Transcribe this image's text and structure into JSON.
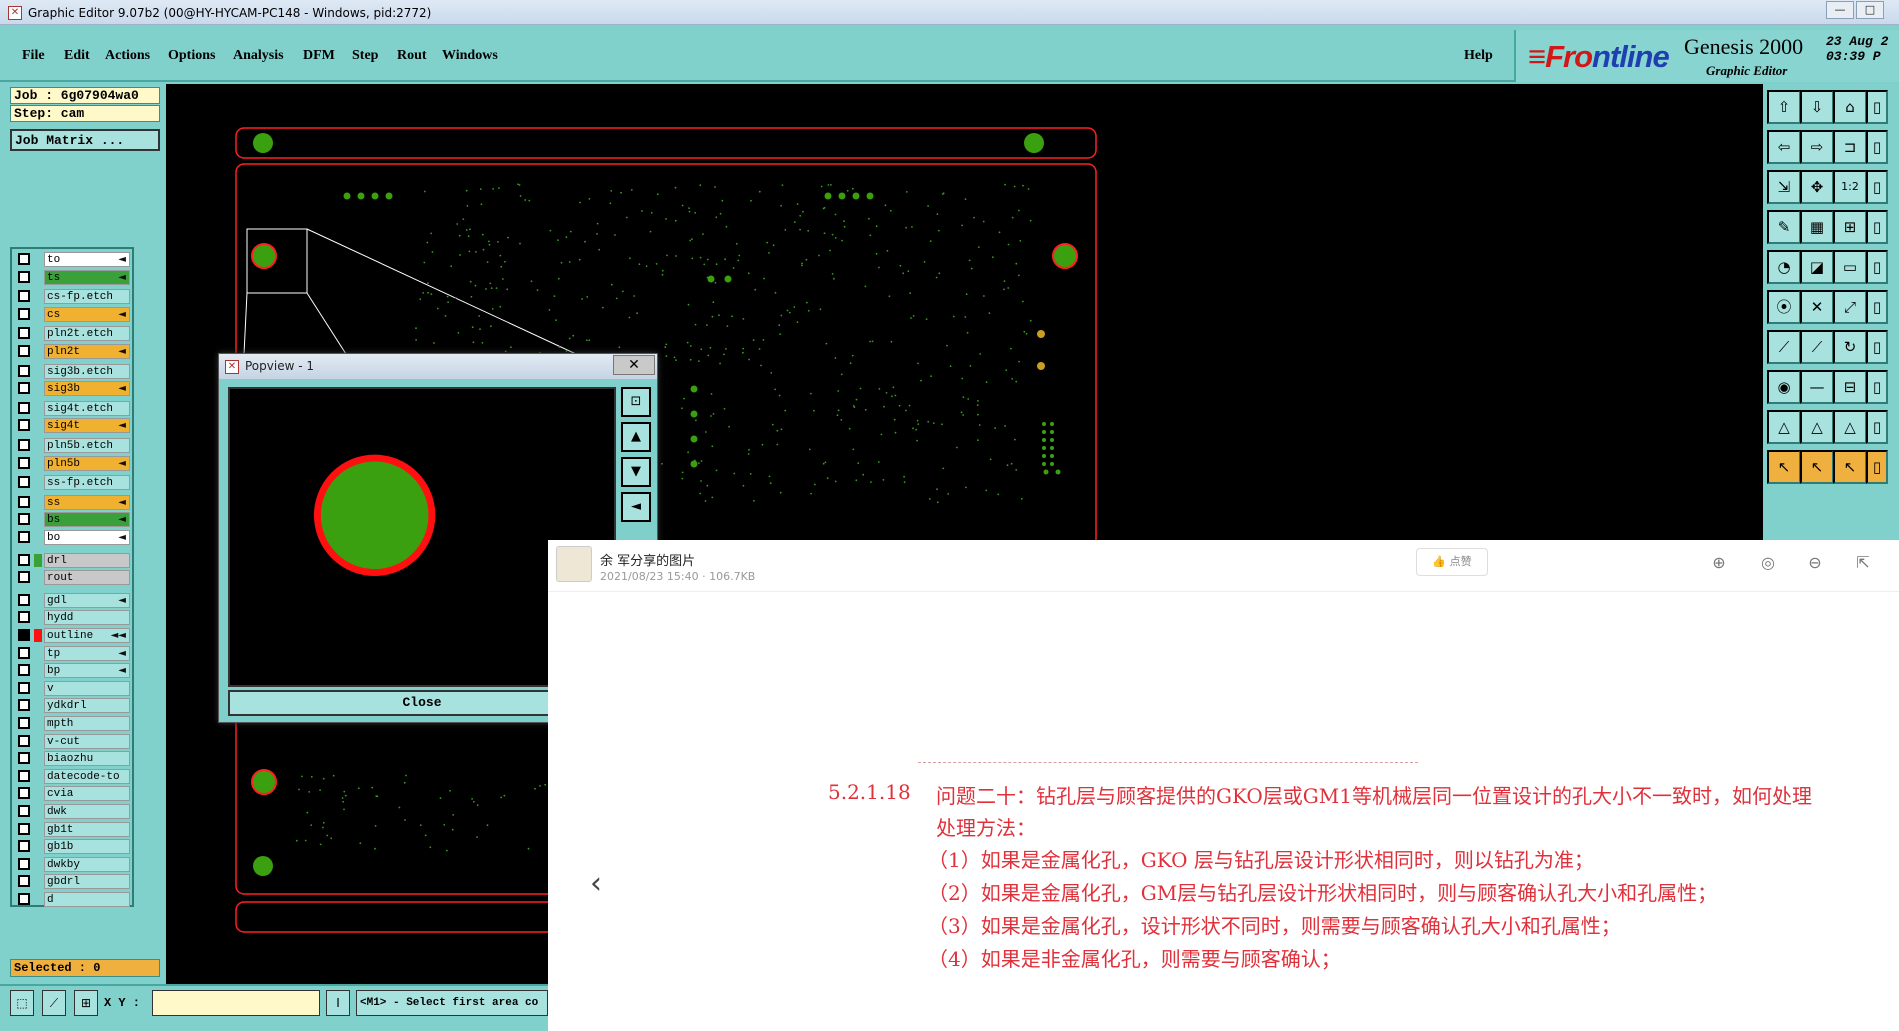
{
  "window": {
    "title": "Graphic Editor 9.07b2 (00@HY-HYCAM-PC148 - Windows, pid:2772)",
    "icon": "app-icon",
    "controls": [
      "minimize-icon",
      "maximize-icon"
    ]
  },
  "menubar": {
    "items": [
      "File",
      "Edit",
      "Actions",
      "Options",
      "Analysis",
      "DFM",
      "Step",
      "Rout",
      "Windows"
    ],
    "help": "Help"
  },
  "brand": {
    "logo_prefix": "≡Fr",
    "logo_o": "o",
    "logo_suffix": "ntline",
    "product": "Genesis 2000",
    "subtitle": "Graphic Editor",
    "date_line1": "23 Aug 2",
    "date_line2": "03:39 P"
  },
  "left": {
    "job_label": "Job  : 6g07904wa0",
    "step_label": "Step: cam",
    "job_matrix": "Job Matrix ...",
    "selected": "Selected : 0",
    "layers": [
      {
        "name": "to",
        "color": "#ffffff",
        "arrow": "◄"
      },
      {
        "name": "ts",
        "color": "#3aa03a",
        "arrow": "◄"
      },
      {
        "name": "cs-fp.etch",
        "color": "#a8e2de",
        "arrow": ""
      },
      {
        "name": "cs",
        "color": "#f0b030",
        "arrow": "◄"
      },
      {
        "name": "pln2t.etch",
        "color": "#a8e2de",
        "arrow": ""
      },
      {
        "name": "pln2t",
        "color": "#f0b030",
        "arrow": "◄"
      },
      {
        "name": "sig3b.etch",
        "color": "#a8e2de",
        "arrow": ""
      },
      {
        "name": "sig3b",
        "color": "#f0b030",
        "arrow": "◄"
      },
      {
        "name": "sig4t.etch",
        "color": "#a8e2de",
        "arrow": ""
      },
      {
        "name": "sig4t",
        "color": "#f0b030",
        "arrow": "◄"
      },
      {
        "name": "pln5b.etch",
        "color": "#a8e2de",
        "arrow": ""
      },
      {
        "name": "pln5b",
        "color": "#f0b030",
        "arrow": "◄"
      },
      {
        "name": "ss-fp.etch",
        "color": "#a8e2de",
        "arrow": ""
      },
      {
        "name": "ss",
        "color": "#f0b030",
        "arrow": "◄"
      },
      {
        "name": "bs",
        "color": "#3aa03a",
        "arrow": "◄"
      },
      {
        "name": "bo",
        "color": "#ffffff",
        "arrow": "◄"
      },
      {
        "name": "drl",
        "color": "#c8c8c8",
        "arrow": ""
      },
      {
        "name": "rout",
        "color": "#c8c8c8",
        "arrow": ""
      },
      {
        "name": "gdl",
        "color": "#a8e2de",
        "arrow": "◄"
      },
      {
        "name": "hydd",
        "color": "#a8e2de",
        "arrow": ""
      },
      {
        "name": "outline",
        "color": "#a8e2de",
        "arrow": "◄◄"
      },
      {
        "name": "tp",
        "color": "#a8e2de",
        "arrow": "◄"
      },
      {
        "name": "bp",
        "color": "#a8e2de",
        "arrow": "◄"
      },
      {
        "name": "v",
        "color": "#a8e2de",
        "arrow": ""
      },
      {
        "name": "ydkdrl",
        "color": "#a8e2de",
        "arrow": ""
      },
      {
        "name": "mpth",
        "color": "#a8e2de",
        "arrow": ""
      },
      {
        "name": "v-cut",
        "color": "#a8e2de",
        "arrow": ""
      },
      {
        "name": "biaozhu",
        "color": "#a8e2de",
        "arrow": ""
      },
      {
        "name": "datecode-to",
        "color": "#a8e2de",
        "arrow": ""
      },
      {
        "name": "cvia",
        "color": "#a8e2de",
        "arrow": ""
      },
      {
        "name": "dwk",
        "color": "#a8e2de",
        "arrow": ""
      },
      {
        "name": "gb1t",
        "color": "#a8e2de",
        "arrow": ""
      },
      {
        "name": "gb1b",
        "color": "#a8e2de",
        "arrow": ""
      },
      {
        "name": "dwkby",
        "color": "#a8e2de",
        "arrow": ""
      },
      {
        "name": "gbdrl",
        "color": "#a8e2de",
        "arrow": ""
      },
      {
        "name": "d",
        "color": "#a8e2de",
        "arrow": ""
      }
    ]
  },
  "bottom": {
    "xy_label": "X Y :",
    "xy_value": "",
    "message": "<M1> - Select first area co"
  },
  "popview": {
    "title": "Popview - 1",
    "close_label": "Close",
    "x_label": "✕"
  },
  "viewer": {
    "user": "余 军分享的图片",
    "meta": "2021/08/23 15:40 · 106.7KB",
    "like": "点赞",
    "prev_icon": "‹",
    "doc_lines": [
      {
        "num": "5.2.1.18",
        "text": "问题二十：钻孔层与顾客提供的GKO层或GM1等机械层同一位置设计的孔大小不一致时，如何处理"
      },
      {
        "num": "",
        "text": "处理方法："
      },
      {
        "num": "",
        "text": "（1）如果是金属化孔，GKO 层与钻孔层设计形状相同时，则以钻孔为准；"
      },
      {
        "num": "",
        "text": "（2）如果是金属化孔，GM层与钻孔层设计形状相同时，则与顾客确认孔大小和孔属性；"
      },
      {
        "num": "",
        "text": "（3）如果是金属化孔，设计形状不同时，则需要与顾客确认孔大小和孔属性；"
      },
      {
        "num": "",
        "text": "（4）如果是非金属化孔，则需要与顾客确认；"
      }
    ]
  },
  "colors": {
    "panel": "#80d0cc",
    "pad_green": "#3aa010",
    "outline_red": "#ff2020",
    "doc_red": "#e0303a"
  }
}
